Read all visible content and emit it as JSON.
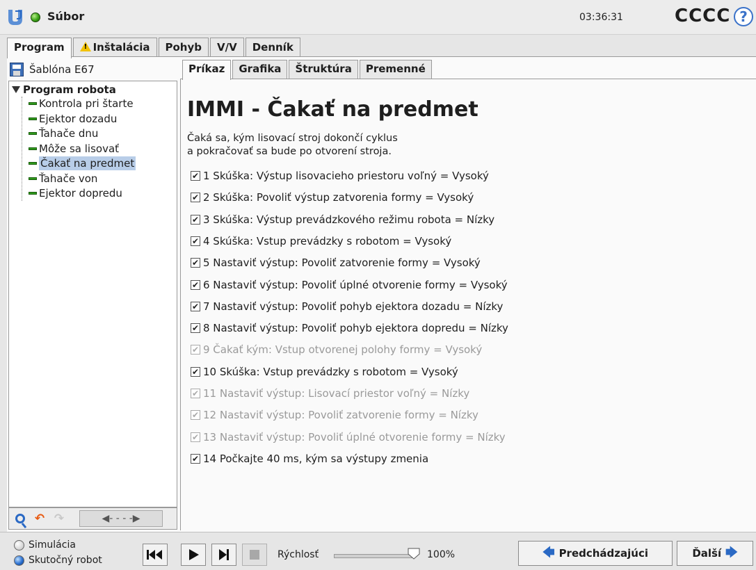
{
  "header": {
    "file_menu": "Súbor",
    "clock": "03:36:31",
    "robot_name": "CCCC",
    "help_symbol": "?"
  },
  "main_tabs": [
    "Program",
    "Inštalácia",
    "Pohyb",
    "V/V",
    "Denník"
  ],
  "program": {
    "file_name": "Šablóna E67",
    "tree_root": "Program robota",
    "tree_items": [
      "Kontrola pri štarte",
      "Ejektor dozadu",
      "Ťahače dnu",
      "Môže sa lisovať",
      "Čakať na predmet",
      "Ťahače von",
      "Ejektor dopredu"
    ],
    "selected_index": 4
  },
  "sub_tabs": [
    "Príkaz",
    "Grafika",
    "Štruktúra",
    "Premenné"
  ],
  "command": {
    "title": "IMMI - Čakať na predmet",
    "description_line1": "Čaká sa, kým lisovací stroj dokončí cyklus",
    "description_line2": "a pokračovať sa bude po otvorení stroja.",
    "items": [
      {
        "text": "1 Skúška: Výstup lisovacieho priestoru voľný = Vysoký",
        "enabled": true
      },
      {
        "text": "2 Skúška: Povoliť výstup zatvorenia formy = Vysoký",
        "enabled": true
      },
      {
        "text": "3 Skúška: Výstup prevádzkového režimu robota = Nízky",
        "enabled": true
      },
      {
        "text": "4 Skúška: Vstup prevádzky s robotom = Vysoký",
        "enabled": true
      },
      {
        "text": "5 Nastaviť výstup: Povoliť zatvorenie formy = Vysoký",
        "enabled": true
      },
      {
        "text": "6 Nastaviť výstup: Povoliť úplné otvorenie formy = Vysoký",
        "enabled": true
      },
      {
        "text": "7 Nastaviť výstup: Povoliť pohyb ejektora dozadu = Nízky",
        "enabled": true
      },
      {
        "text": "8 Nastaviť výstup: Povoliť pohyb ejektora dopredu = Nízky",
        "enabled": true
      },
      {
        "text": "9 Čakať kým: Vstup otvorenej polohy formy = Vysoký",
        "enabled": false
      },
      {
        "text": "10 Skúška: Vstup prevádzky s robotom = Vysoký",
        "enabled": true
      },
      {
        "text": "11 Nastaviť výstup: Lisovací priestor voľný = Nízky",
        "enabled": false
      },
      {
        "text": "12 Nastaviť výstup: Povoliť zatvorenie formy = Nízky",
        "enabled": false
      },
      {
        "text": "13 Nastaviť výstup: Povoliť úplné otvorenie formy = Nízky",
        "enabled": false
      },
      {
        "text": "14 Počkajte 40 ms, kým sa výstupy zmenia",
        "enabled": true
      }
    ],
    "check_symbol": "✔"
  },
  "footer": {
    "mode_simulation": "Simulácia",
    "mode_real": "Skutočný robot",
    "selected_mode": "real",
    "speed_label": "Rýchlosť",
    "speed_value": "100%",
    "speed_fraction": 1.0,
    "prev_label": "Predchádzajúci",
    "next_label": "Ďalší"
  },
  "colors": {
    "accent_blue": "#2a69c4",
    "status_green": "#3aa316",
    "warning_yellow": "#f2c200",
    "selection": "#b8cde8",
    "disabled_text": "#9a9a9a"
  }
}
